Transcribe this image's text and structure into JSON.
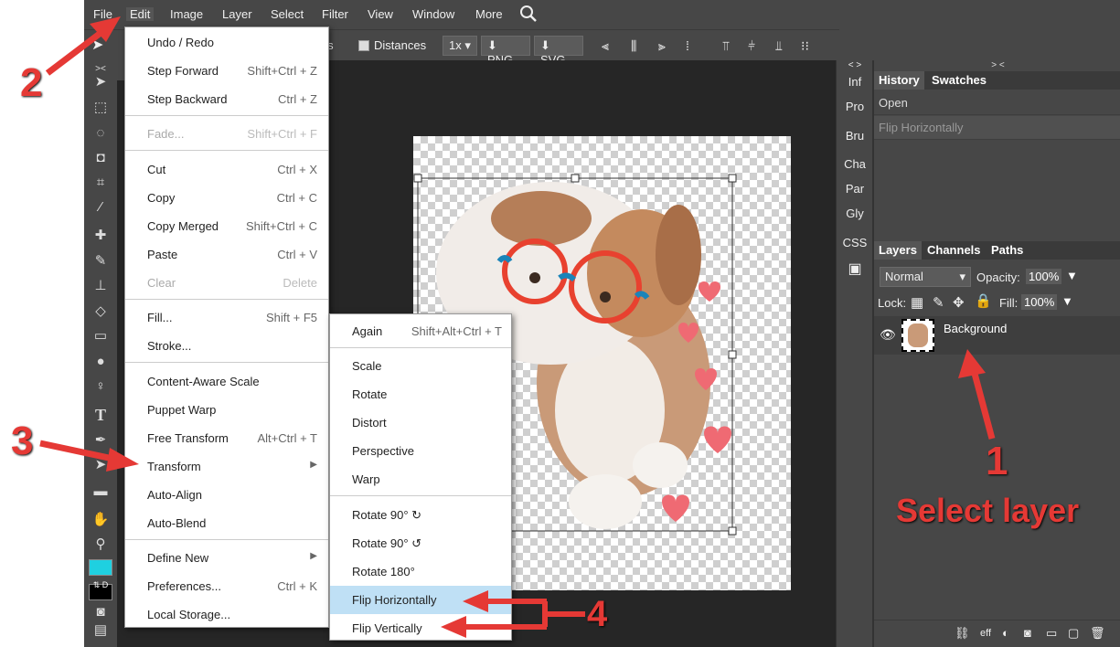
{
  "menubar": {
    "items": [
      "File",
      "Edit",
      "Image",
      "Layer",
      "Select",
      "Filter",
      "View",
      "Window",
      "More"
    ]
  },
  "options": {
    "tools_partial": "ols",
    "distances_label": "Distances",
    "zoom_select": "1x",
    "png_label": "PNG",
    "svg_label": "SVG"
  },
  "edit_menu": {
    "items": [
      {
        "label": "Undo / Redo",
        "shortcut": ""
      },
      {
        "label": "Step Forward",
        "shortcut": "Shift+Ctrl + Z"
      },
      {
        "label": "Step Backward",
        "shortcut": "Ctrl + Z"
      },
      {
        "label": "Fade...",
        "shortcut": "Shift+Ctrl + F"
      },
      {
        "label": "Cut",
        "shortcut": "Ctrl + X"
      },
      {
        "label": "Copy",
        "shortcut": "Ctrl + C"
      },
      {
        "label": "Copy Merged",
        "shortcut": "Shift+Ctrl + C"
      },
      {
        "label": "Paste",
        "shortcut": "Ctrl + V"
      },
      {
        "label": "Clear",
        "shortcut": "Delete"
      },
      {
        "label": "Fill...",
        "shortcut": "Shift + F5"
      },
      {
        "label": "Stroke...",
        "shortcut": ""
      },
      {
        "label": "Content-Aware Scale",
        "shortcut": ""
      },
      {
        "label": "Puppet Warp",
        "shortcut": ""
      },
      {
        "label": "Free Transform",
        "shortcut": "Alt+Ctrl + T"
      },
      {
        "label": "Transform",
        "shortcut": "▶"
      },
      {
        "label": "Auto-Align",
        "shortcut": ""
      },
      {
        "label": "Auto-Blend",
        "shortcut": ""
      },
      {
        "label": "Define New",
        "shortcut": "▶"
      },
      {
        "label": "Preferences...",
        "shortcut": "Ctrl + K"
      },
      {
        "label": "Local Storage...",
        "shortcut": ""
      }
    ]
  },
  "transform_menu": {
    "items": [
      {
        "label": "Again",
        "shortcut": "Shift+Alt+Ctrl + T"
      },
      {
        "label": "Scale"
      },
      {
        "label": "Rotate"
      },
      {
        "label": "Distort"
      },
      {
        "label": "Perspective"
      },
      {
        "label": "Warp"
      },
      {
        "label": "Rotate 90° ↻"
      },
      {
        "label": "Rotate 90° ↺"
      },
      {
        "label": "Rotate 180°"
      },
      {
        "label": "Flip Horizontally"
      },
      {
        "label": "Flip Vertically"
      }
    ]
  },
  "mini_panels": [
    "Inf",
    "Pro",
    "Bru",
    "Cha",
    "Par",
    "Gly",
    "CSS"
  ],
  "history_panel": {
    "tabs": [
      "History",
      "Swatches"
    ],
    "entries": [
      "Open",
      "Flip Horizontally"
    ]
  },
  "layers_panel": {
    "tabs": [
      "Layers",
      "Channels",
      "Paths"
    ],
    "blend_mode": "Normal",
    "opacity_label": "Opacity:",
    "opacity_value": "100%",
    "lock_label": "Lock:",
    "fill_label": "Fill:",
    "fill_value": "100%",
    "layer_name": "Background",
    "eff_label": "eff"
  },
  "annotations": {
    "step1_number": "1",
    "step1_text": "Select layer",
    "step2_number": "2",
    "step3_number": "3",
    "step4_number": "4",
    "color": "#e53935"
  },
  "colors": {
    "foreground_swatch": "#1fd0e0",
    "background_swatch": "#000000",
    "highlight": "#bfe0f5",
    "dark_ui": "#474747"
  }
}
